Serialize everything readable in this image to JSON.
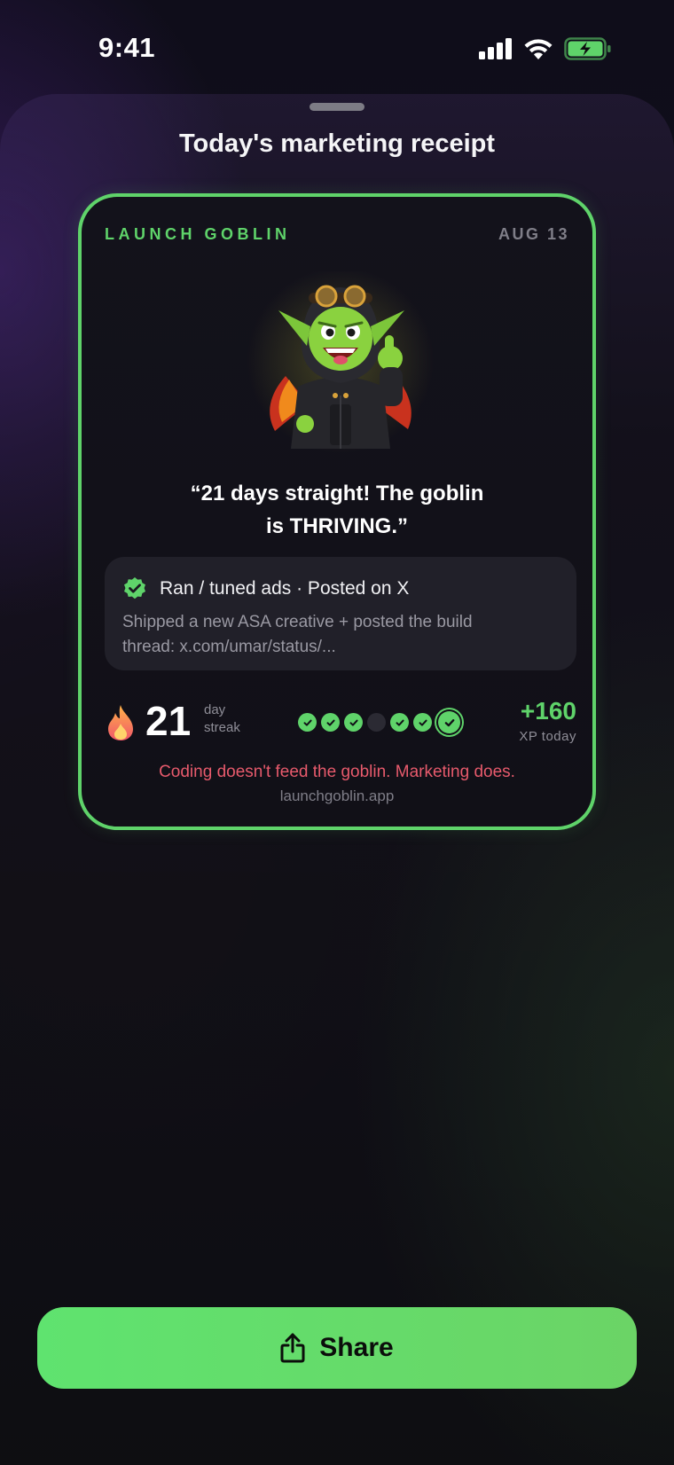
{
  "status_bar": {
    "time": "9:41",
    "icons": [
      "cellular-signal-icon",
      "wifi-icon",
      "battery-charging-icon"
    ],
    "battery_color": "#5fd36a"
  },
  "sheet": {
    "title": "Today's marketing receipt"
  },
  "card": {
    "brand": "LAUNCH GOBLIN",
    "date": "AUG 13",
    "mascot_icon": "goblin-mascot-icon",
    "quote_line1": "“21 days straight! The goblin",
    "quote_line2": "is THRIVING.”",
    "activity": {
      "check_icon": "verified-check-icon",
      "title": "Ran / tuned ads · Posted on X",
      "description_line1": "Shipped a new ASA creative + posted the build",
      "description_line2": "thread: x.com/umar/status/..."
    },
    "streak": {
      "flame_icon": "flame-icon",
      "number": "21",
      "label_day": "day",
      "label_streak": "streak"
    },
    "week": [
      "done",
      "done",
      "done",
      "miss",
      "done",
      "done",
      "today"
    ],
    "xp": {
      "value": "+160",
      "label": "XP today"
    },
    "tagline": "Coding doesn't feed the goblin. Marketing does.",
    "url": "launchgoblin.app"
  },
  "share_button": {
    "label": "Share",
    "icon": "share-icon"
  },
  "colors": {
    "accent_green": "#5fd36a",
    "tagline_red": "#e75a6c",
    "muted_text": "#7f7e88"
  }
}
